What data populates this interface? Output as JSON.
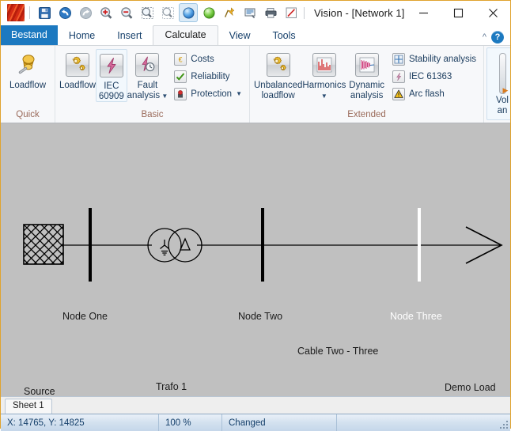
{
  "window": {
    "title": "Vision - [Network 1]",
    "app_icon": "vision-app-icon",
    "minimize_label": "Minimize",
    "maximize_label": "Maximize",
    "close_label": "Close"
  },
  "quick_access": [
    {
      "name": "save-icon",
      "label": "Save"
    },
    {
      "name": "undo-icon",
      "label": "Undo"
    },
    {
      "name": "redo-icon",
      "label": "Redo"
    },
    {
      "name": "zoom-in-icon",
      "label": "Zoom in"
    },
    {
      "name": "zoom-out-icon",
      "label": "Zoom out"
    },
    {
      "name": "zoom-window-icon",
      "label": "Zoom window"
    },
    {
      "name": "zoom-all-icon",
      "label": "Zoom all"
    },
    {
      "name": "blue-sphere-icon",
      "label": "Blue node"
    },
    {
      "name": "green-sphere-icon",
      "label": "Green node"
    },
    {
      "name": "pin-icon",
      "label": "Pin"
    },
    {
      "name": "print-preview-icon",
      "label": "Print preview"
    },
    {
      "name": "print-icon",
      "label": "Print"
    },
    {
      "name": "edit-icon",
      "label": "Edit"
    }
  ],
  "tabs": [
    {
      "label": "Bestand",
      "type": "file"
    },
    {
      "label": "Home",
      "type": "normal"
    },
    {
      "label": "Insert",
      "type": "normal"
    },
    {
      "label": "Calculate",
      "type": "active"
    },
    {
      "label": "View",
      "type": "normal"
    },
    {
      "label": "Tools",
      "type": "normal"
    }
  ],
  "tab_strip_right": {
    "collapse_icon": "chevron-up-icon",
    "help_icon": "help-icon",
    "help_label": "?"
  },
  "ribbon": {
    "groups": [
      {
        "name": "quick",
        "label": "Quick",
        "big_buttons": [
          {
            "label": "Loadflow",
            "icon": "pushpin-icon",
            "framed": false,
            "caret": false
          }
        ],
        "small_buttons": []
      },
      {
        "name": "basic",
        "label": "Basic",
        "big_buttons": [
          {
            "label": "Loadflow",
            "icon": "gears-icon",
            "framed": false,
            "caret": false
          },
          {
            "label": "IEC\n60909",
            "line1": "IEC",
            "line2": "60909",
            "icon": "lightning-icon",
            "framed": true,
            "caret": false
          },
          {
            "label": "Fault\nanalysis",
            "line1": "Fault",
            "line2": "analysis",
            "icon": "fault-analysis-icon",
            "framed": false,
            "caret": true
          }
        ],
        "small_buttons": [
          {
            "label": "Costs",
            "icon": "euro-icon",
            "caret": false
          },
          {
            "label": "Reliability",
            "icon": "checkmark-icon",
            "caret": false
          },
          {
            "label": "Protection",
            "icon": "relay-icon",
            "caret": true
          }
        ]
      },
      {
        "name": "extended",
        "label": "Extended",
        "big_buttons": [
          {
            "label": "Unbalanced\nloadflow",
            "line1": "Unbalanced",
            "line2": "loadflow",
            "icon": "gears-icon",
            "framed": false,
            "caret": false
          },
          {
            "label": "Harmonics",
            "line1": "Harmonics",
            "line2": "",
            "icon": "harmonics-bars-icon",
            "framed": false,
            "caret": true
          },
          {
            "label": "Dynamic\nanalysis",
            "line1": "Dynamic",
            "line2": "analysis",
            "icon": "dynamic-waveform-icon",
            "framed": false,
            "caret": false
          }
        ],
        "small_buttons": [
          {
            "label": "Stability analysis",
            "icon": "stability-cross-icon",
            "caret": false
          },
          {
            "label": "IEC 61363",
            "icon": "iec61363-icon",
            "caret": false
          },
          {
            "label": "Arc flash",
            "icon": "warning-triangle-icon",
            "caret": false
          }
        ]
      }
    ],
    "cut_off_group": {
      "name": "voltage-analysis-partial",
      "line1": "Vol",
      "line2": "an",
      "scroll_icon": "scroll-thumb",
      "more_icon": "more-arrow-icon"
    }
  },
  "diagram": {
    "background_color": "#c0c0c0",
    "elements": [
      {
        "name": "source",
        "label": "Source",
        "type": "hatched-square"
      },
      {
        "name": "node-one",
        "label": "Node One",
        "type": "busbar",
        "color": "#000000"
      },
      {
        "name": "trafo-1",
        "label": "Trafo 1",
        "type": "two-winding-transformer",
        "winding1": "Y",
        "winding2": "Δ"
      },
      {
        "name": "node-two",
        "label": "Node Two",
        "type": "busbar",
        "color": "#000000"
      },
      {
        "name": "cable-two-three",
        "label": "Cable Two - Three",
        "type": "cable"
      },
      {
        "name": "node-three",
        "label": "Node Three",
        "type": "busbar",
        "color": "#ffffff",
        "selected": true
      },
      {
        "name": "demo-load",
        "label": "Demo Load",
        "type": "load-arrow"
      }
    ]
  },
  "sheets": [
    {
      "label": "Sheet 1",
      "active": true
    }
  ],
  "status_bar": {
    "coordinates": "X: 14765, Y: 14825",
    "zoom": "100 %",
    "state": "Changed",
    "empty1": "",
    "resize_grip": "resize-grip-icon"
  },
  "colors": {
    "accent": "#1c79c0",
    "window_border": "#e0a32e",
    "group_label": "#9a6a5a",
    "canvas": "#c0c0c0",
    "selection": "#ffffff"
  }
}
